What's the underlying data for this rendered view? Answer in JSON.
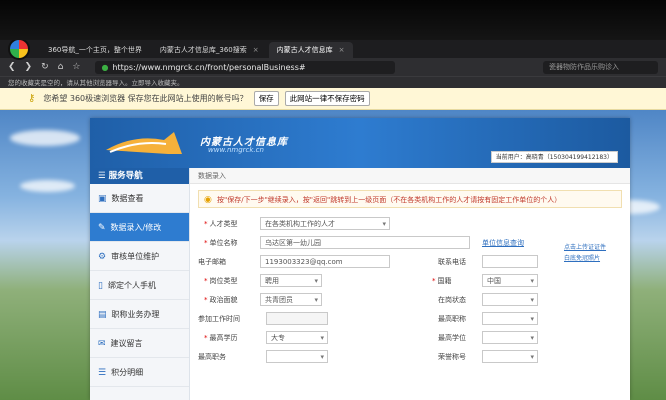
{
  "browser": {
    "tabs": [
      {
        "label": "360导航_一个主页，整个世界",
        "active": false
      },
      {
        "label": "内蒙古人才信息库_360搜索",
        "active": false
      },
      {
        "label": "内蒙古人才信息库",
        "active": true
      }
    ],
    "url": "https://www.nmgrck.cn/front/personalBusiness#",
    "search_hint": "瓷器物防作品乐购诊入",
    "bookmarks_text": "您的收藏夹是空的，请从其他浏览器导入。立即导入收藏夹。"
  },
  "password_bar": {
    "message": "您希望 360极速浏览器 保存您在此网站上使用的帐号吗？",
    "save_label": "保存",
    "never_label": "此网站一律不保存密码"
  },
  "site": {
    "name": "内蒙古人才信息库",
    "domain": "www.nmgrck.cn",
    "user_label": "当前用户：高晓青（150304199412183）"
  },
  "sidebar": {
    "title": "服务导航",
    "items": [
      {
        "label": "数据查看",
        "icon": "monitor-icon"
      },
      {
        "label": "数据录入/修改",
        "icon": "edit-icon"
      },
      {
        "label": "审核单位维护",
        "icon": "gear-icon"
      },
      {
        "label": "绑定个人手机",
        "icon": "phone-icon"
      },
      {
        "label": "职称业务办理",
        "icon": "file-icon"
      },
      {
        "label": "建议留言",
        "icon": "message-icon"
      },
      {
        "label": "积分明细",
        "icon": "list-icon"
      }
    ]
  },
  "content": {
    "breadcrumb": "数据录入",
    "notice": "按\"保存/下一步\"继续录入，按\"返回\"跳转到上一级页面（不在各类机构工作的人才请按有固定工作单位的个人）",
    "form": {
      "talent_type_label": "人才类型",
      "talent_type_value": "在各类机构工作的人才",
      "unit_label": "单位名称",
      "unit_value": "乌达区第一幼儿园",
      "unit_query_link": "单位信息查询",
      "upload_link_1": "点击上传证证件",
      "upload_link_2": "白底免冠照片",
      "email_label": "电子邮箱",
      "email_value": "1193003323@qq.com",
      "phone_label": "联系电话",
      "post_type_label": "岗位类型",
      "post_type_value": "聘用",
      "nationality_label": "国籍",
      "nationality_value": "中国",
      "political_label": "政治面貌",
      "political_value": "共青团员",
      "job_status_label": "在岗状态",
      "work_time_label": "参加工作时间",
      "title_label": "最高职称",
      "education_label": "最高学历",
      "education_value": "大专",
      "degree_label": "最高学位",
      "position_label": "最高职务",
      "honor_label": "荣誉称号"
    }
  }
}
